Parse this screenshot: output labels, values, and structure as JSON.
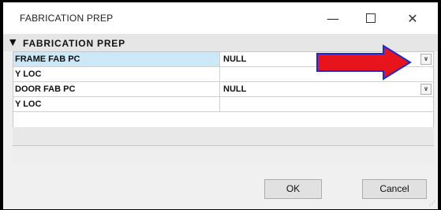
{
  "window": {
    "title": "FABRICATION PREP",
    "minimize_glyph": "—",
    "close_glyph": "✕"
  },
  "section": {
    "caret_glyph": "▼",
    "title": "FABRICATION PREP"
  },
  "properties": [
    {
      "name": "FRAME FAB PC",
      "value": "NULL",
      "has_dropdown": true,
      "selected": true
    },
    {
      "name": "Y LOC",
      "value": "",
      "has_dropdown": false,
      "selected": false
    },
    {
      "name": "DOOR FAB PC",
      "value": "NULL",
      "has_dropdown": true,
      "selected": false
    },
    {
      "name": "Y LOC",
      "value": "",
      "has_dropdown": false,
      "selected": false
    }
  ],
  "dropdown_glyph": "∨",
  "buttons": {
    "ok": "OK",
    "cancel": "Cancel"
  },
  "colors": {
    "selected_row": "#cce8f6",
    "annotation_arrow_fill": "#e8141b",
    "annotation_arrow_stroke": "#1a2bd6"
  }
}
